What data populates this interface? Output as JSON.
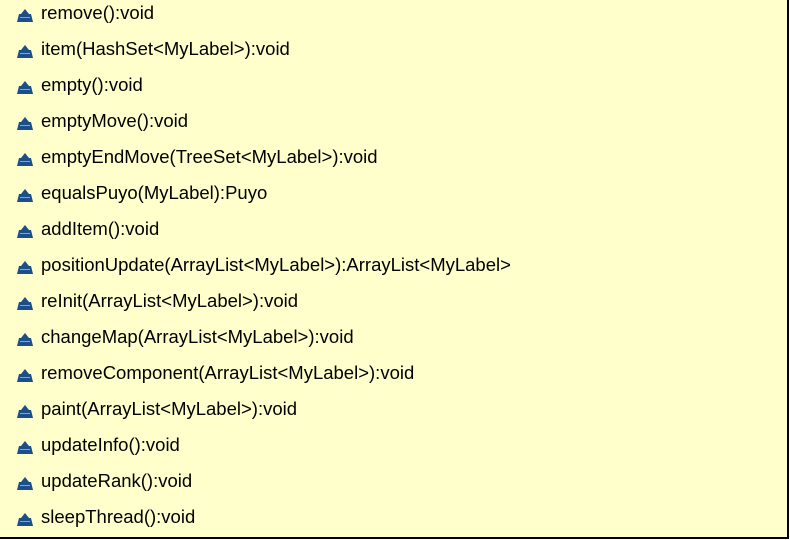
{
  "class_box": {
    "fill_color": "#ffffcc",
    "border_color": "#000000",
    "icon_name": "protected-visibility-icon",
    "icon_color": "#1a4f8a",
    "methods": [
      "remove():void",
      "item(HashSet<MyLabel>):void",
      "empty():void",
      "emptyMove():void",
      "emptyEndMove(TreeSet<MyLabel>):void",
      "equalsPuyo(MyLabel):Puyo",
      "addItem():void",
      "positionUpdate(ArrayList<MyLabel>):ArrayList<MyLabel>",
      "reInit(ArrayList<MyLabel>):void",
      "changeMap(ArrayList<MyLabel>):void",
      "removeComponent(ArrayList<MyLabel>):void",
      "paint(ArrayList<MyLabel>):void",
      "updateInfo():void",
      "updateRank():void",
      "sleepThread():void"
    ]
  }
}
